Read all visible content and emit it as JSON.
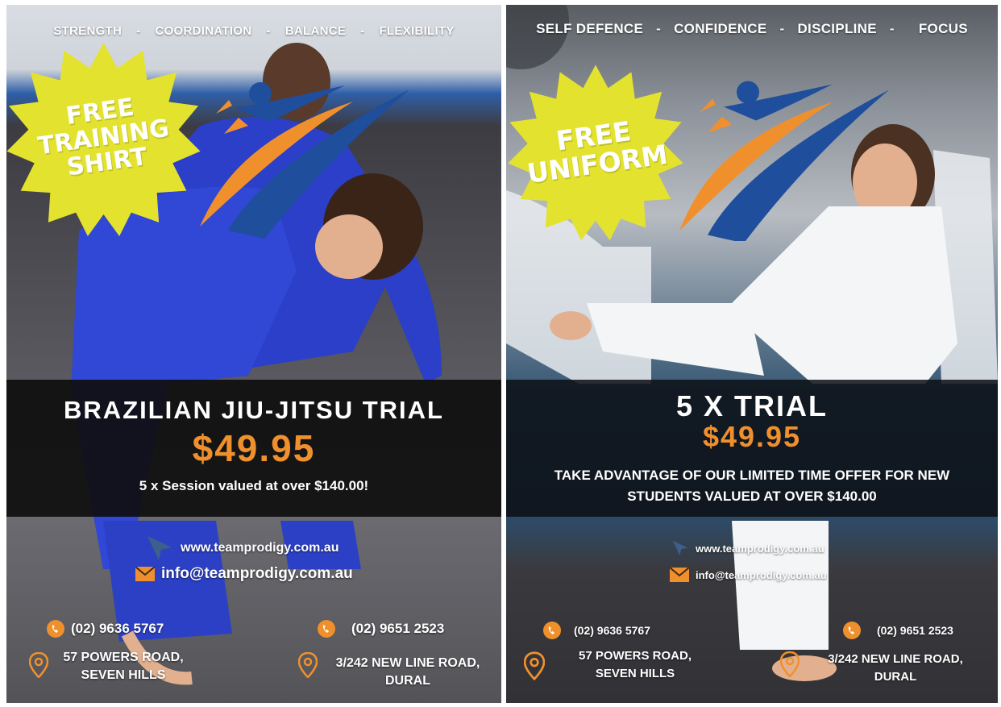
{
  "colors": {
    "accent_orange": "#f0902d",
    "star_yellow": "#e3e22f",
    "logo_blue": "#1f4e9c",
    "band_black": "#0e0e0e"
  },
  "left": {
    "tagline": [
      "STRENGTH",
      "COORDINATION",
      "BALANCE",
      "FLEXIBILITY"
    ],
    "separator": "-",
    "starburst_lines": [
      "FREE",
      "TRAINING",
      "SHIRT"
    ],
    "offer_title": "BRAZILIAN JIU-JITSU TRIAL",
    "offer_price": "$49.95",
    "offer_sub": "5 x Session valued at over $140.00!",
    "website": "www.teamprodigy.com.au",
    "email": "info@teamprodigy.com.au",
    "phone_1": "(02) 9636 5767",
    "phone_2": "(02) 9651 2523",
    "address_1_line1": "57 POWERS ROAD,",
    "address_1_line2": "SEVEN HILLS",
    "address_2_line1": "3/242 NEW LINE ROAD,",
    "address_2_line2": "DURAL",
    "icons": [
      "cursor-icon",
      "mail-icon",
      "phone-icon",
      "location-pin-icon"
    ]
  },
  "right": {
    "tagline": [
      "SELF DEFENCE",
      "CONFIDENCE",
      "DISCIPLINE",
      "FOCUS"
    ],
    "separator": "-",
    "starburst_lines": [
      "FREE",
      "UNIFORM"
    ],
    "offer_title": "5 X TRIAL",
    "offer_price": "$49.95",
    "offer_sub": "TAKE ADVANTAGE OF OUR LIMITED TIME OFFER FOR NEW STUDENTS VALUED AT OVER $140.00",
    "website": "www.teamprodigy.com.au",
    "email": "info@teamprodigy.com.au",
    "phone_1": "(02) 9636 5767",
    "phone_2": "(02) 9651 2523",
    "address_1_line1": "57 POWERS ROAD,",
    "address_1_line2": "SEVEN HILLS",
    "address_2_line1": "3/242 NEW LINE ROAD,",
    "address_2_line2": "DURAL",
    "icons": [
      "cursor-icon",
      "mail-icon",
      "phone-icon",
      "location-pin-icon"
    ]
  }
}
